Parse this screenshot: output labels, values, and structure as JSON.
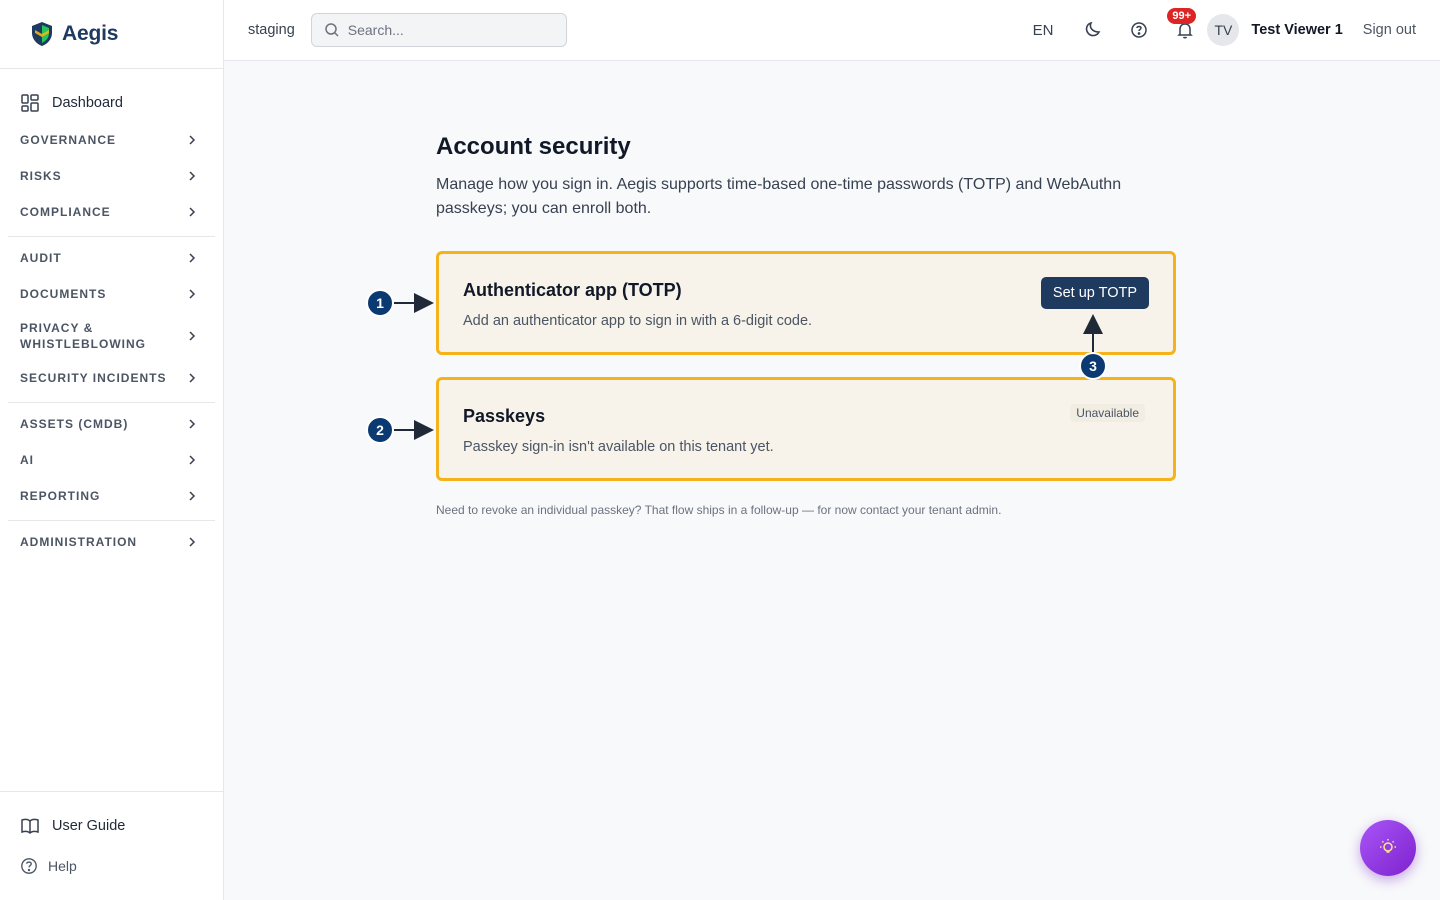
{
  "brand": {
    "name": "Aegis"
  },
  "sidebar": {
    "dashboard": "Dashboard",
    "groups": [
      [
        "Governance",
        "Risks",
        "Compliance"
      ],
      [
        "Audit",
        "Documents",
        "Privacy & Whistleblowing",
        "Security Incidents"
      ],
      [
        "Assets (CMDB)",
        "AI",
        "Reporting"
      ],
      [
        "Administration"
      ]
    ],
    "bottom": {
      "guide": "User Guide",
      "help": "Help"
    }
  },
  "header": {
    "env": "staging",
    "search_placeholder": "Search...",
    "lang": "EN",
    "notif_badge": "99+",
    "avatar_initials": "TV",
    "user_name": "Test Viewer 1",
    "sign_out": "Sign out"
  },
  "main": {
    "title": "Account security",
    "description": "Manage how you sign in. Aegis supports time-based one-time passwords (TOTP) and WebAuthn passkeys; you can enroll both.",
    "totp": {
      "title": "Authenticator app (TOTP)",
      "subtitle": "Add an authenticator app to sign in with a 6-digit code.",
      "button": "Set up TOTP"
    },
    "passkeys": {
      "title": "Passkeys",
      "subtitle": "Passkey sign-in isn't available on this tenant yet.",
      "status": "Unavailable"
    },
    "footnote": "Need to revoke an individual passkey? That flow ships in a follow-up — for now contact your tenant admin."
  },
  "annotations": [
    "1",
    "2",
    "3"
  ],
  "colors": {
    "brand": "#1e3a5f",
    "highlight": "#f5b31b",
    "marker": "#0b3a73",
    "badge": "#dc2626",
    "fab": "#9333ea"
  }
}
